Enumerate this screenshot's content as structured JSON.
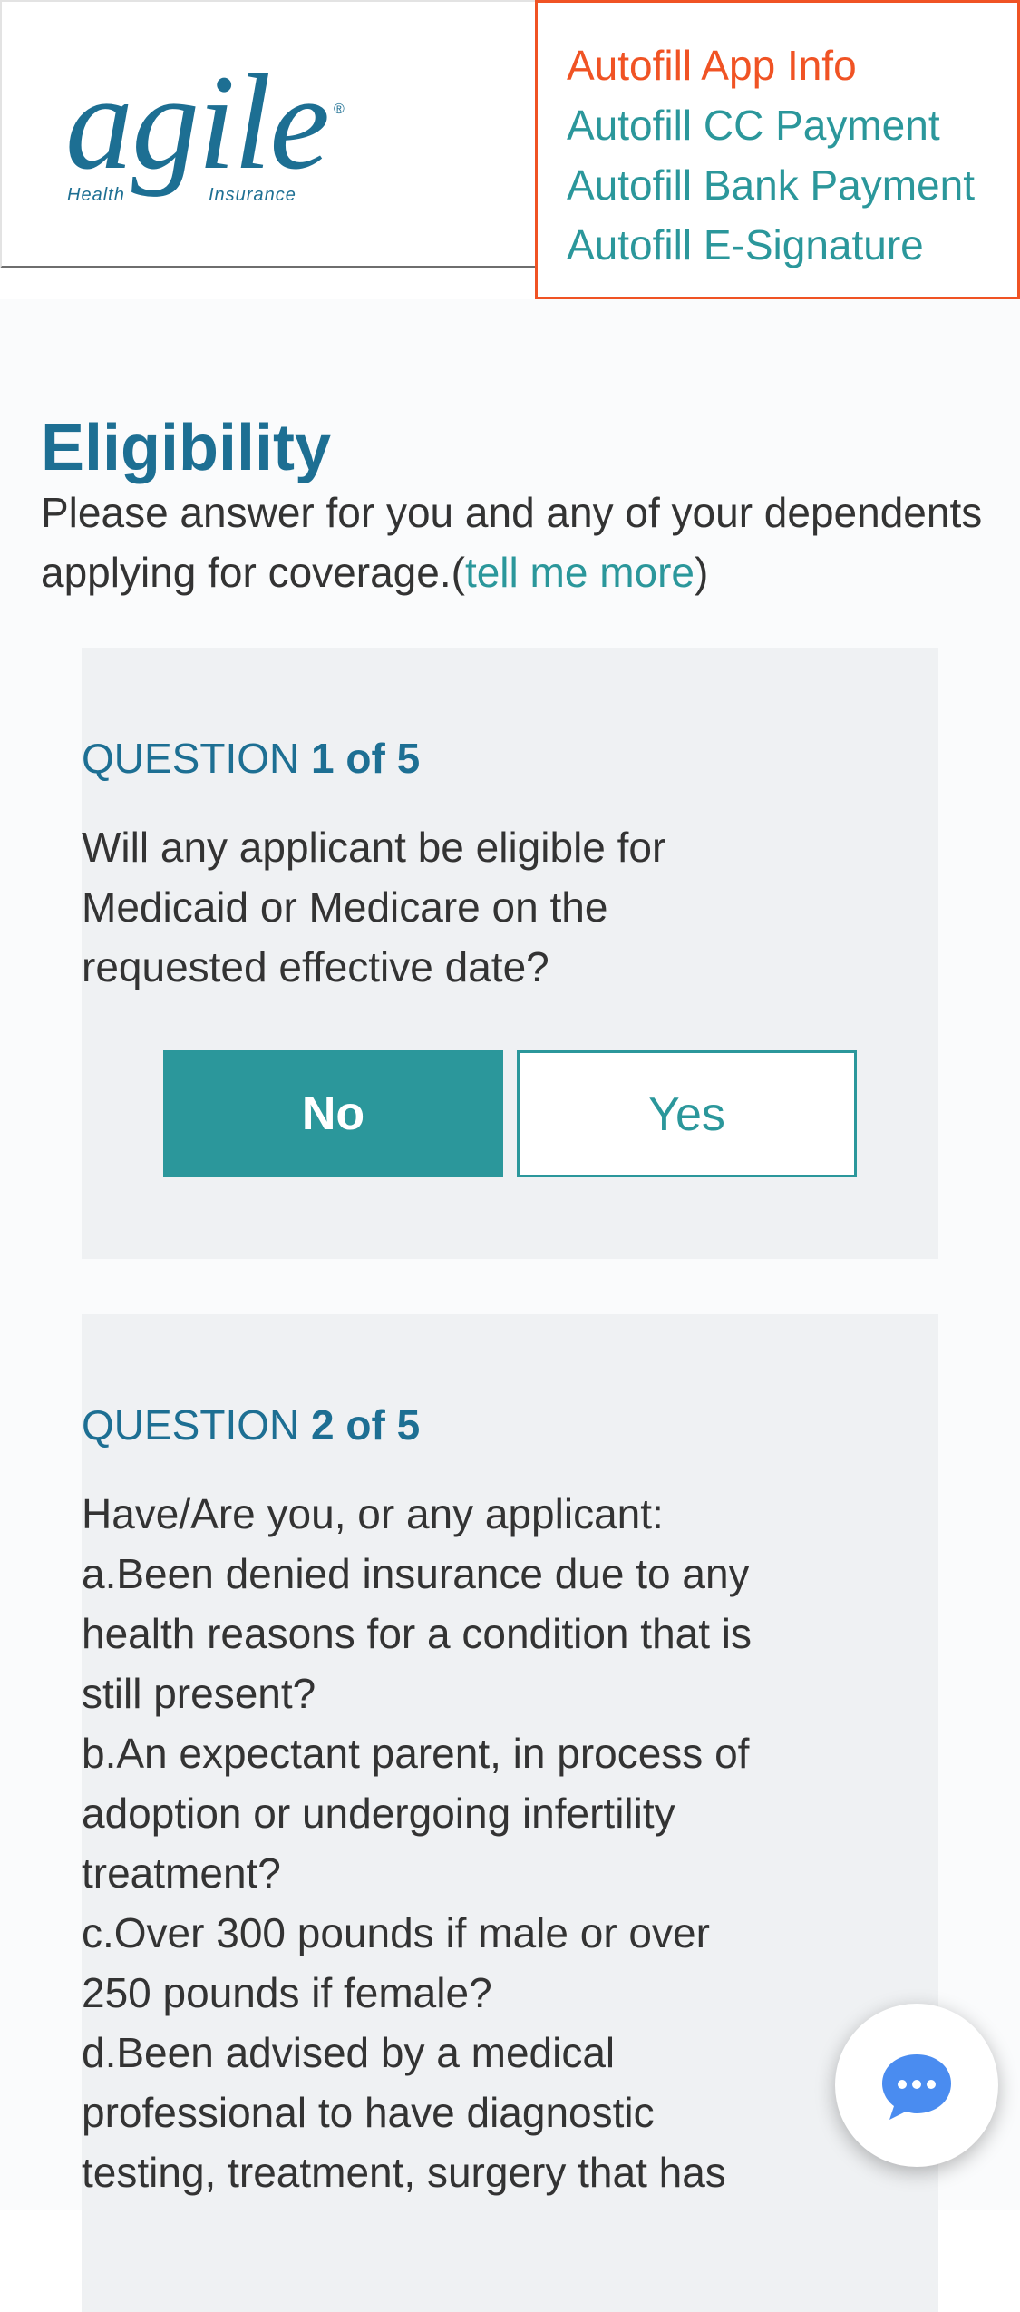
{
  "logo": {
    "word": "agile",
    "registered": "®",
    "tag_left": "Health",
    "tag_right": "Insurance",
    "color": "#1d6f93"
  },
  "autofill": {
    "items": [
      {
        "label": "Autofill App Info"
      },
      {
        "label": "Autofill CC Payment"
      },
      {
        "label": "Autofill Bank Payment"
      },
      {
        "label": "Autofill E-Signature"
      }
    ],
    "border_color": "#f05324",
    "link_color": "#2b979b"
  },
  "eligibility": {
    "title": "Eligibility",
    "intro_text": "Please answer for you and any of your dependents applying for coverage.(",
    "more_link": "tell me more",
    "intro_close": ")"
  },
  "questions": [
    {
      "label_prefix": "QUESTION ",
      "label_number": "1 of 5",
      "text": "Will any applicant be eligible for Medicaid or Medicare on the requested effective date?",
      "answers": {
        "no": "No",
        "yes": "Yes"
      },
      "selected": "No"
    },
    {
      "label_prefix": "QUESTION ",
      "label_number": "2 of 5",
      "lines": [
        "Have/Are you, or any applicant:",
        "a.Been denied insurance due to any health reasons for a condition that is still present?",
        "b.An expectant parent, in process of adoption or undergoing infertility treatment?",
        "c.Over 300 pounds if male or over 250 pounds if female?",
        "d.Been advised by a medical professional to have diagnostic testing, treatment, surgery that has"
      ]
    }
  ],
  "chat": {
    "icon": "chat-bubble-icon",
    "color": "#4a8cf0"
  },
  "colors": {
    "primary": "#1d6f93",
    "accent": "#2b979b",
    "card_bg": "#eff1f3"
  }
}
